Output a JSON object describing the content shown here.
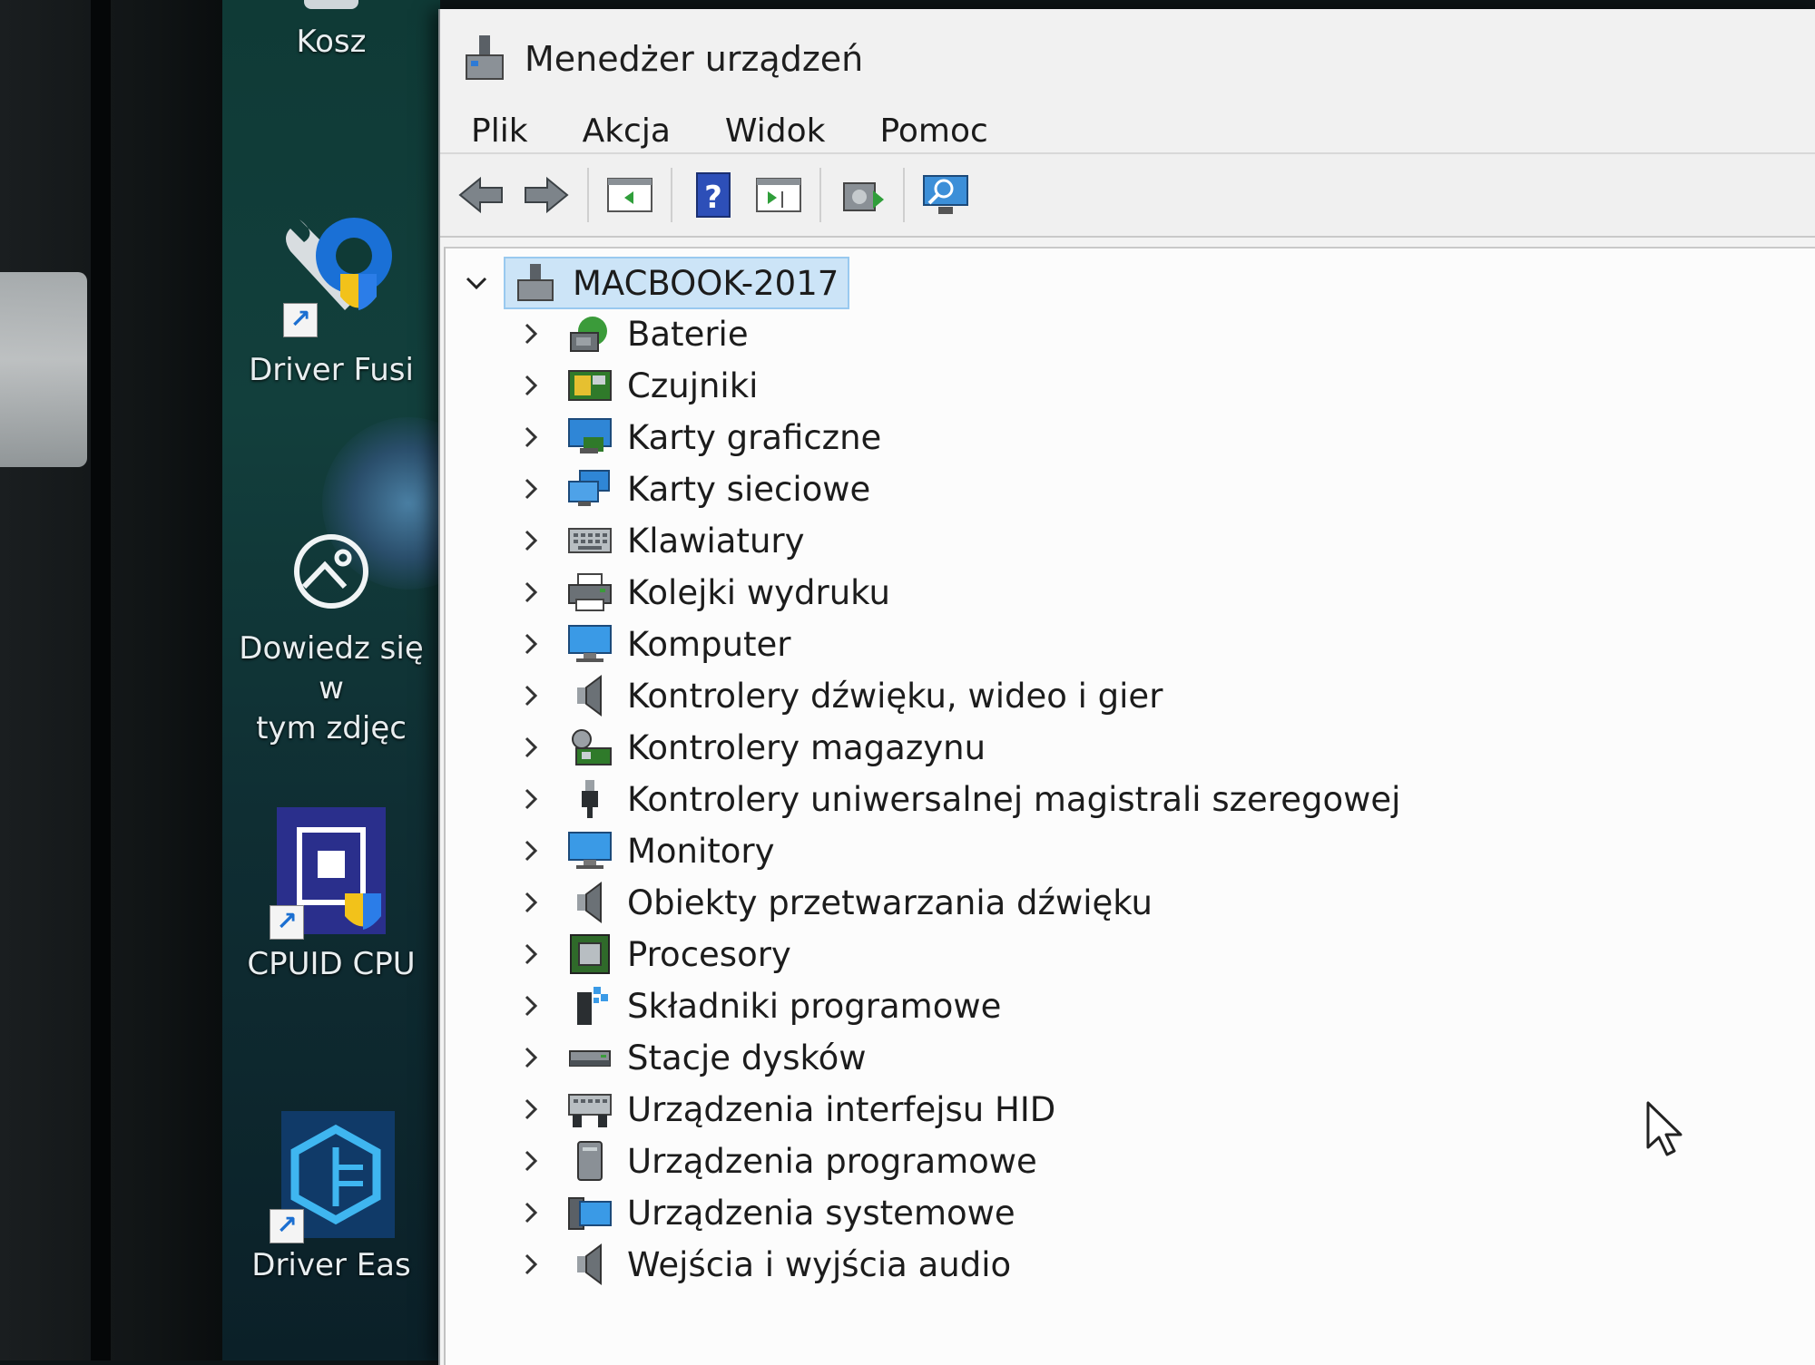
{
  "desktop": {
    "icons": [
      {
        "name": "recycle-bin",
        "label": "Kosz"
      },
      {
        "name": "driver-fusion",
        "label": "Driver Fusi"
      },
      {
        "name": "learn-about-picture",
        "label": "Dowiedz się w\ntym zdjęc"
      },
      {
        "name": "cpuid",
        "label": "CPUID CPU"
      },
      {
        "name": "driver-easy",
        "label": "Driver Eas"
      }
    ]
  },
  "window": {
    "title": "Menedżer urządzeń",
    "menu": [
      "Plik",
      "Akcja",
      "Widok",
      "Pomoc"
    ],
    "toolbar": [
      "back-icon",
      "forward-icon",
      "show-hide-console-tree-icon",
      "help-icon",
      "properties-pane-icon",
      "update-driver-icon",
      "scan-hardware-icon"
    ]
  },
  "tree": {
    "root": "MACBOOK-2017",
    "items": [
      {
        "label": "Baterie",
        "icon": "battery-icon"
      },
      {
        "label": "Czujniki",
        "icon": "sensor-icon"
      },
      {
        "label": "Karty graficzne",
        "icon": "display-adapter-icon"
      },
      {
        "label": "Karty sieciowe",
        "icon": "network-adapter-icon"
      },
      {
        "label": "Klawiatury",
        "icon": "keyboard-icon"
      },
      {
        "label": "Kolejki wydruku",
        "icon": "printer-icon"
      },
      {
        "label": "Komputer",
        "icon": "computer-icon"
      },
      {
        "label": "Kontrolery dźwięku, wideo i gier",
        "icon": "speaker-icon"
      },
      {
        "label": "Kontrolery magazynu",
        "icon": "storage-controller-icon"
      },
      {
        "label": "Kontrolery uniwersalnej magistrali szeregowej",
        "icon": "usb-icon"
      },
      {
        "label": "Monitory",
        "icon": "monitor-icon"
      },
      {
        "label": "Obiekty przetwarzania dźwięku",
        "icon": "speaker-icon"
      },
      {
        "label": "Procesory",
        "icon": "processor-icon"
      },
      {
        "label": "Składniki programowe",
        "icon": "software-component-icon"
      },
      {
        "label": "Stacje dysków",
        "icon": "disk-drive-icon"
      },
      {
        "label": "Urządzenia interfejsu HID",
        "icon": "hid-icon"
      },
      {
        "label": "Urządzenia programowe",
        "icon": "software-device-icon"
      },
      {
        "label": "Urządzenia systemowe",
        "icon": "system-device-icon"
      },
      {
        "label": "Wejścia i wyjścia audio",
        "icon": "speaker-icon"
      }
    ]
  },
  "colors": {
    "selection_bg": "#cce4f7",
    "selection_border": "#99c9ef",
    "window_bg": "#f3f3f3",
    "desktop_bg": "#123f3c"
  }
}
